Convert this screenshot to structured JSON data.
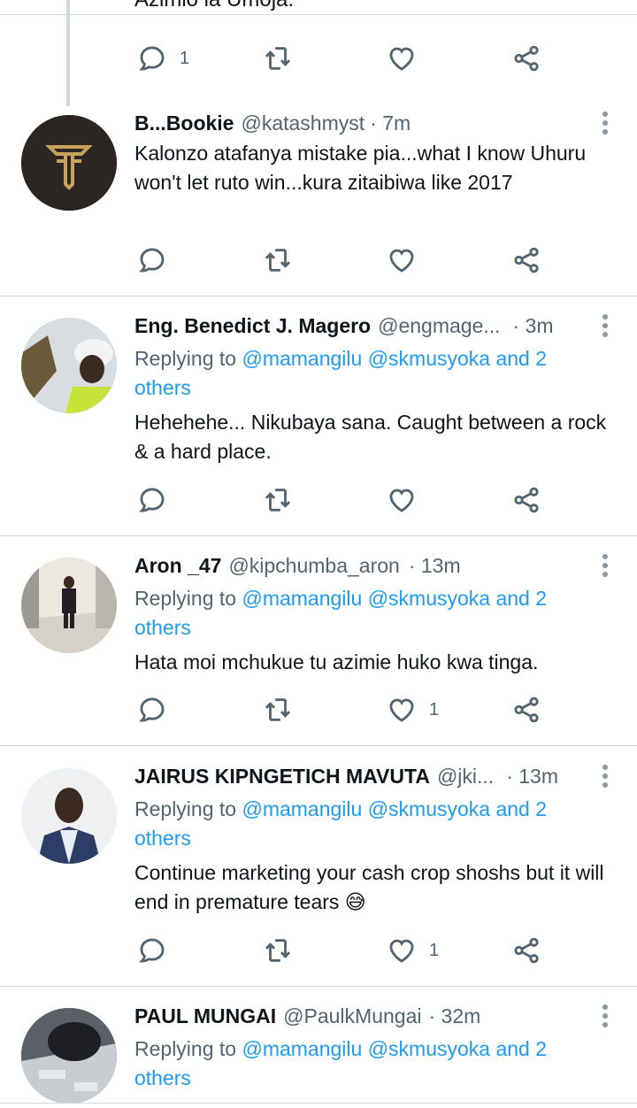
{
  "top_partial": {
    "cut_text": "Azimio la Umoja.",
    "reply_count": "1"
  },
  "tweets": [
    {
      "name": "B...Bookie",
      "handle": "@katashmyst",
      "time": "· 7m",
      "reply_prefix": "",
      "mentions": "",
      "reply_suffix": "",
      "text": "Kalonzo atafanya mistake pia...what I know Uhuru won't let ruto win...kura zitaibiwa like 2017",
      "likes": ""
    },
    {
      "name": "Eng. Benedict  J. Magero",
      "handle": "@engmage...",
      "time": "· 3m",
      "reply_prefix": "Replying to ",
      "mentions": "@mamangilu @skmusyoka and 2 others",
      "reply_suffix": "",
      "text": "Hehehehe... Nikubaya sana. Caught between a rock & a hard place.",
      "likes": ""
    },
    {
      "name": "Aron _47",
      "handle": "@kipchumba_aron",
      "time": "· 13m",
      "reply_prefix": "Replying to ",
      "mentions": "@mamangilu @skmusyoka and 2 others",
      "reply_suffix": "",
      "text": "Hata moi mchukue tu azimie huko kwa tinga.",
      "likes": "1"
    },
    {
      "name": "JAIRUS KIPNGETICH MAVUTA",
      "handle": "@jki...",
      "time": "· 13m",
      "reply_prefix": "Replying to ",
      "mentions": "@mamangilu @skmusyoka and 2 others",
      "reply_suffix": "",
      "text": "Continue marketing your cash crop shoshs but it will end in premature tears 😅",
      "likes": "1"
    },
    {
      "name": "PAUL MUNGAI",
      "handle": "@PaulkMungai",
      "time": "· 32m",
      "reply_prefix": "Replying to ",
      "mentions": "@mamangilu @skmusyoka and 2 others",
      "reply_suffix": "",
      "text": "",
      "likes": ""
    }
  ],
  "icons": {
    "reply": "reply-icon",
    "retweet": "retweet-icon",
    "like": "heart-icon",
    "share": "share-icon",
    "more": "more-vertical-icon"
  },
  "colors": {
    "text": "#0f1419",
    "secondary": "#536471",
    "accent": "#1d9bf0",
    "divider": "#cfd9de"
  }
}
